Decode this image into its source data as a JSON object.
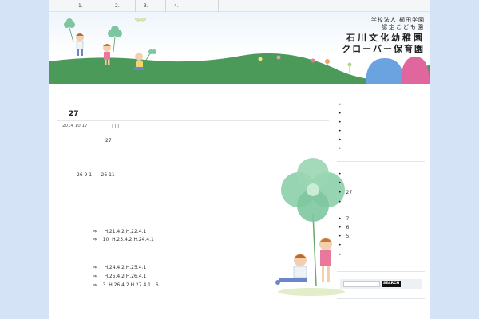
{
  "nav": {
    "items": [
      "1.",
      "2.",
      "3.",
      "4."
    ]
  },
  "header": {
    "logo": {
      "line1": "学校法人 櫛田学園",
      "line2": "認定こども園",
      "line3": "石川文化幼稚園",
      "line4": "クローバー保育園"
    }
  },
  "post": {
    "title": "27",
    "date": "2014 10 17",
    "meta_separators": "|   |   |   |",
    "lines": [
      "27",
      "26 9 1      26 11",
      "⇒     H.21.4.2 H.22.4.1",
      "⇒    10  H.23.4.2 H.24.4.1",
      "⇒     H.24.4.2 H.25.4.1",
      "⇒     H.25.4.2 H.26.4.1",
      "⇒    3  H.26.4.2 H.27.4.1   6"
    ]
  },
  "sidebar": {
    "widget1": [
      "",
      "",
      "",
      "",
      "",
      ""
    ],
    "widget2": [
      "",
      "",
      "27",
      "",
      "7",
      "6",
      "5",
      "",
      ""
    ],
    "search": {
      "placeholder": "",
      "button_label": "SEARCH"
    }
  },
  "colors": {
    "background": "#d4e3f5",
    "hill": "#4c9a5a",
    "blue_dome": "#6aa3e0",
    "pink_dome": "#e0669e",
    "clover": "#7ec6a0"
  }
}
